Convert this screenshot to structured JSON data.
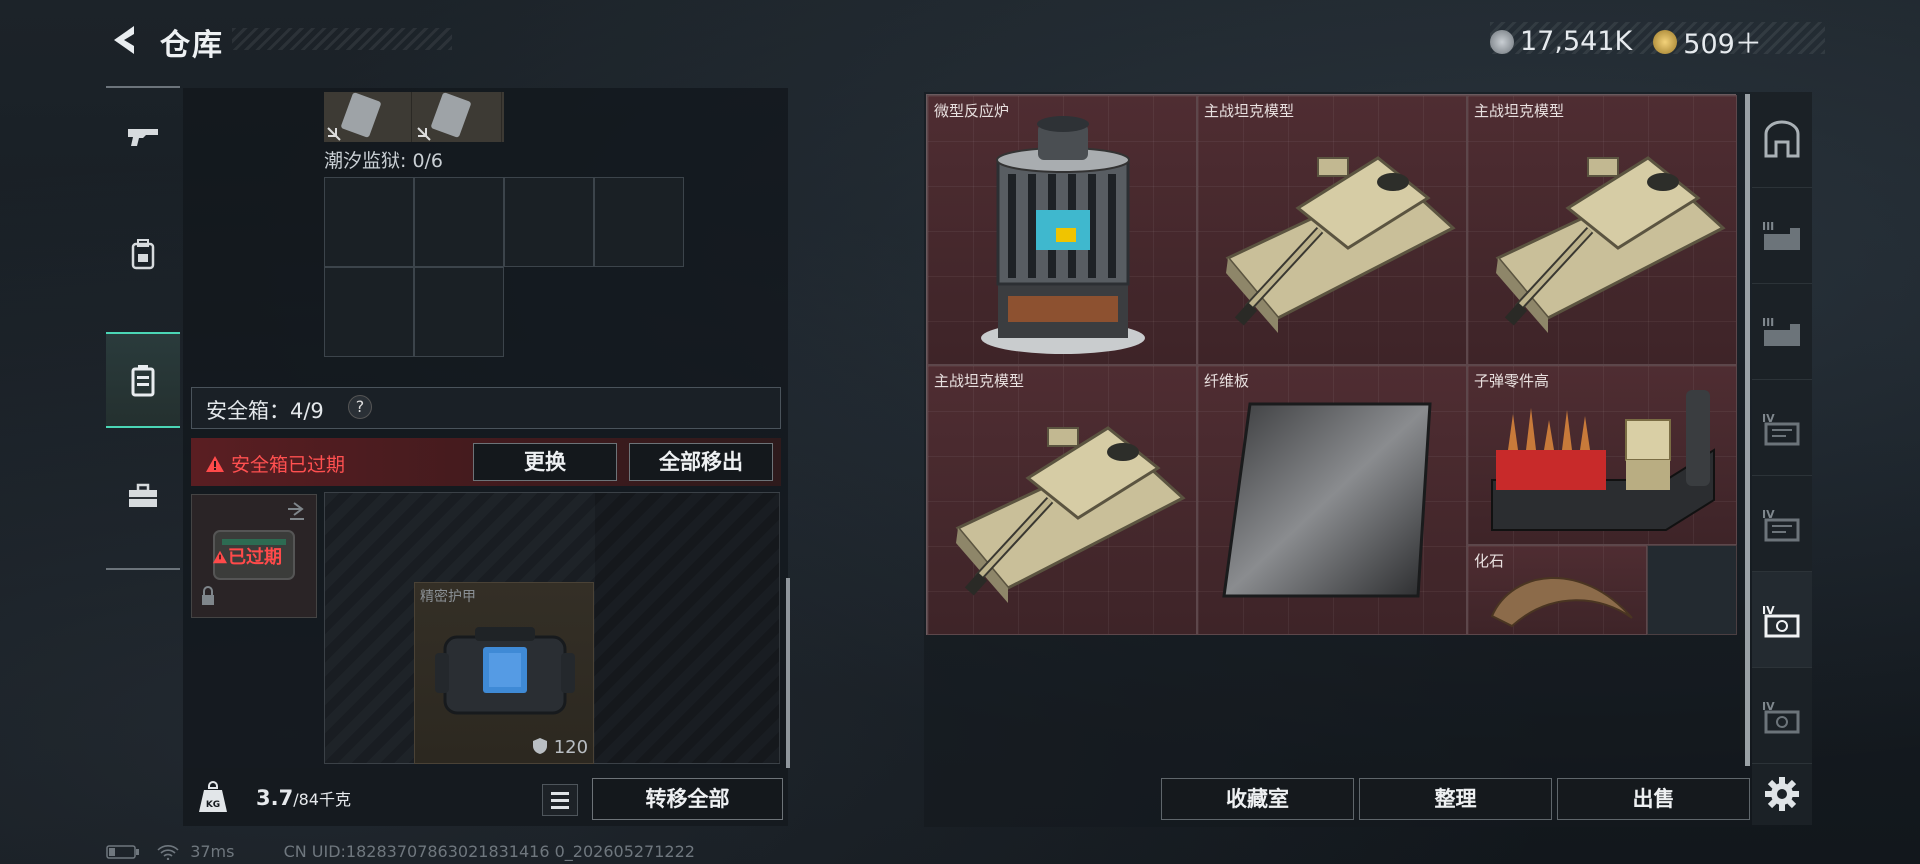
{
  "header": {
    "title": "仓库",
    "currency_1": "17,541K",
    "currency_2": "509＋"
  },
  "left_nav": [
    "gun-icon",
    "backpack-icon",
    "safe-box-icon",
    "toolbox-icon"
  ],
  "left_panel": {
    "tide_prison_label": "潮汐监狱: 0/6",
    "safe_box_label": "安全箱：4/9",
    "help_mark": "?",
    "expired_text": "安全箱已过期",
    "replace_button": "更换",
    "remove_all_button": "全部移出",
    "case_expired_label": "已过期",
    "armor": {
      "name": "精密护甲",
      "durability": "120"
    },
    "weight_current": "3.7",
    "weight_max": "/84千克",
    "transfer_all_button": "转移全部"
  },
  "status_bar": {
    "ping": "37ms",
    "uid": "CN UID:18283707863021831416 0_202605271222"
  },
  "items": [
    {
      "name": "微型反应炉",
      "icon": "reactor-icon"
    },
    {
      "name": "主战坦克模型",
      "icon": "tank-icon"
    },
    {
      "name": "主战坦克模型",
      "icon": "tank-icon"
    },
    {
      "name": "主战坦克模型",
      "icon": "tank-icon"
    },
    {
      "name": "纤维板",
      "icon": "fiber-board-icon"
    },
    {
      "name": "子弹零件高",
      "icon": "bullet-parts-icon"
    },
    {
      "name": "化石",
      "icon": "fossil-icon"
    }
  ],
  "right_buttons": {
    "collection": "收藏室",
    "sort": "整理",
    "sell": "出售"
  },
  "right_nav": [
    "home-icon",
    "tier3-container-icon",
    "tier3-container-icon",
    "tier4-container-icon",
    "tier4-container-icon",
    "tier4-safe-icon",
    "tier4-safe-icon",
    "settings-icon"
  ],
  "colors": {
    "accent": "#4bd6b6",
    "expired_red": "#ff5050",
    "item_bg": "#4d2c31"
  }
}
